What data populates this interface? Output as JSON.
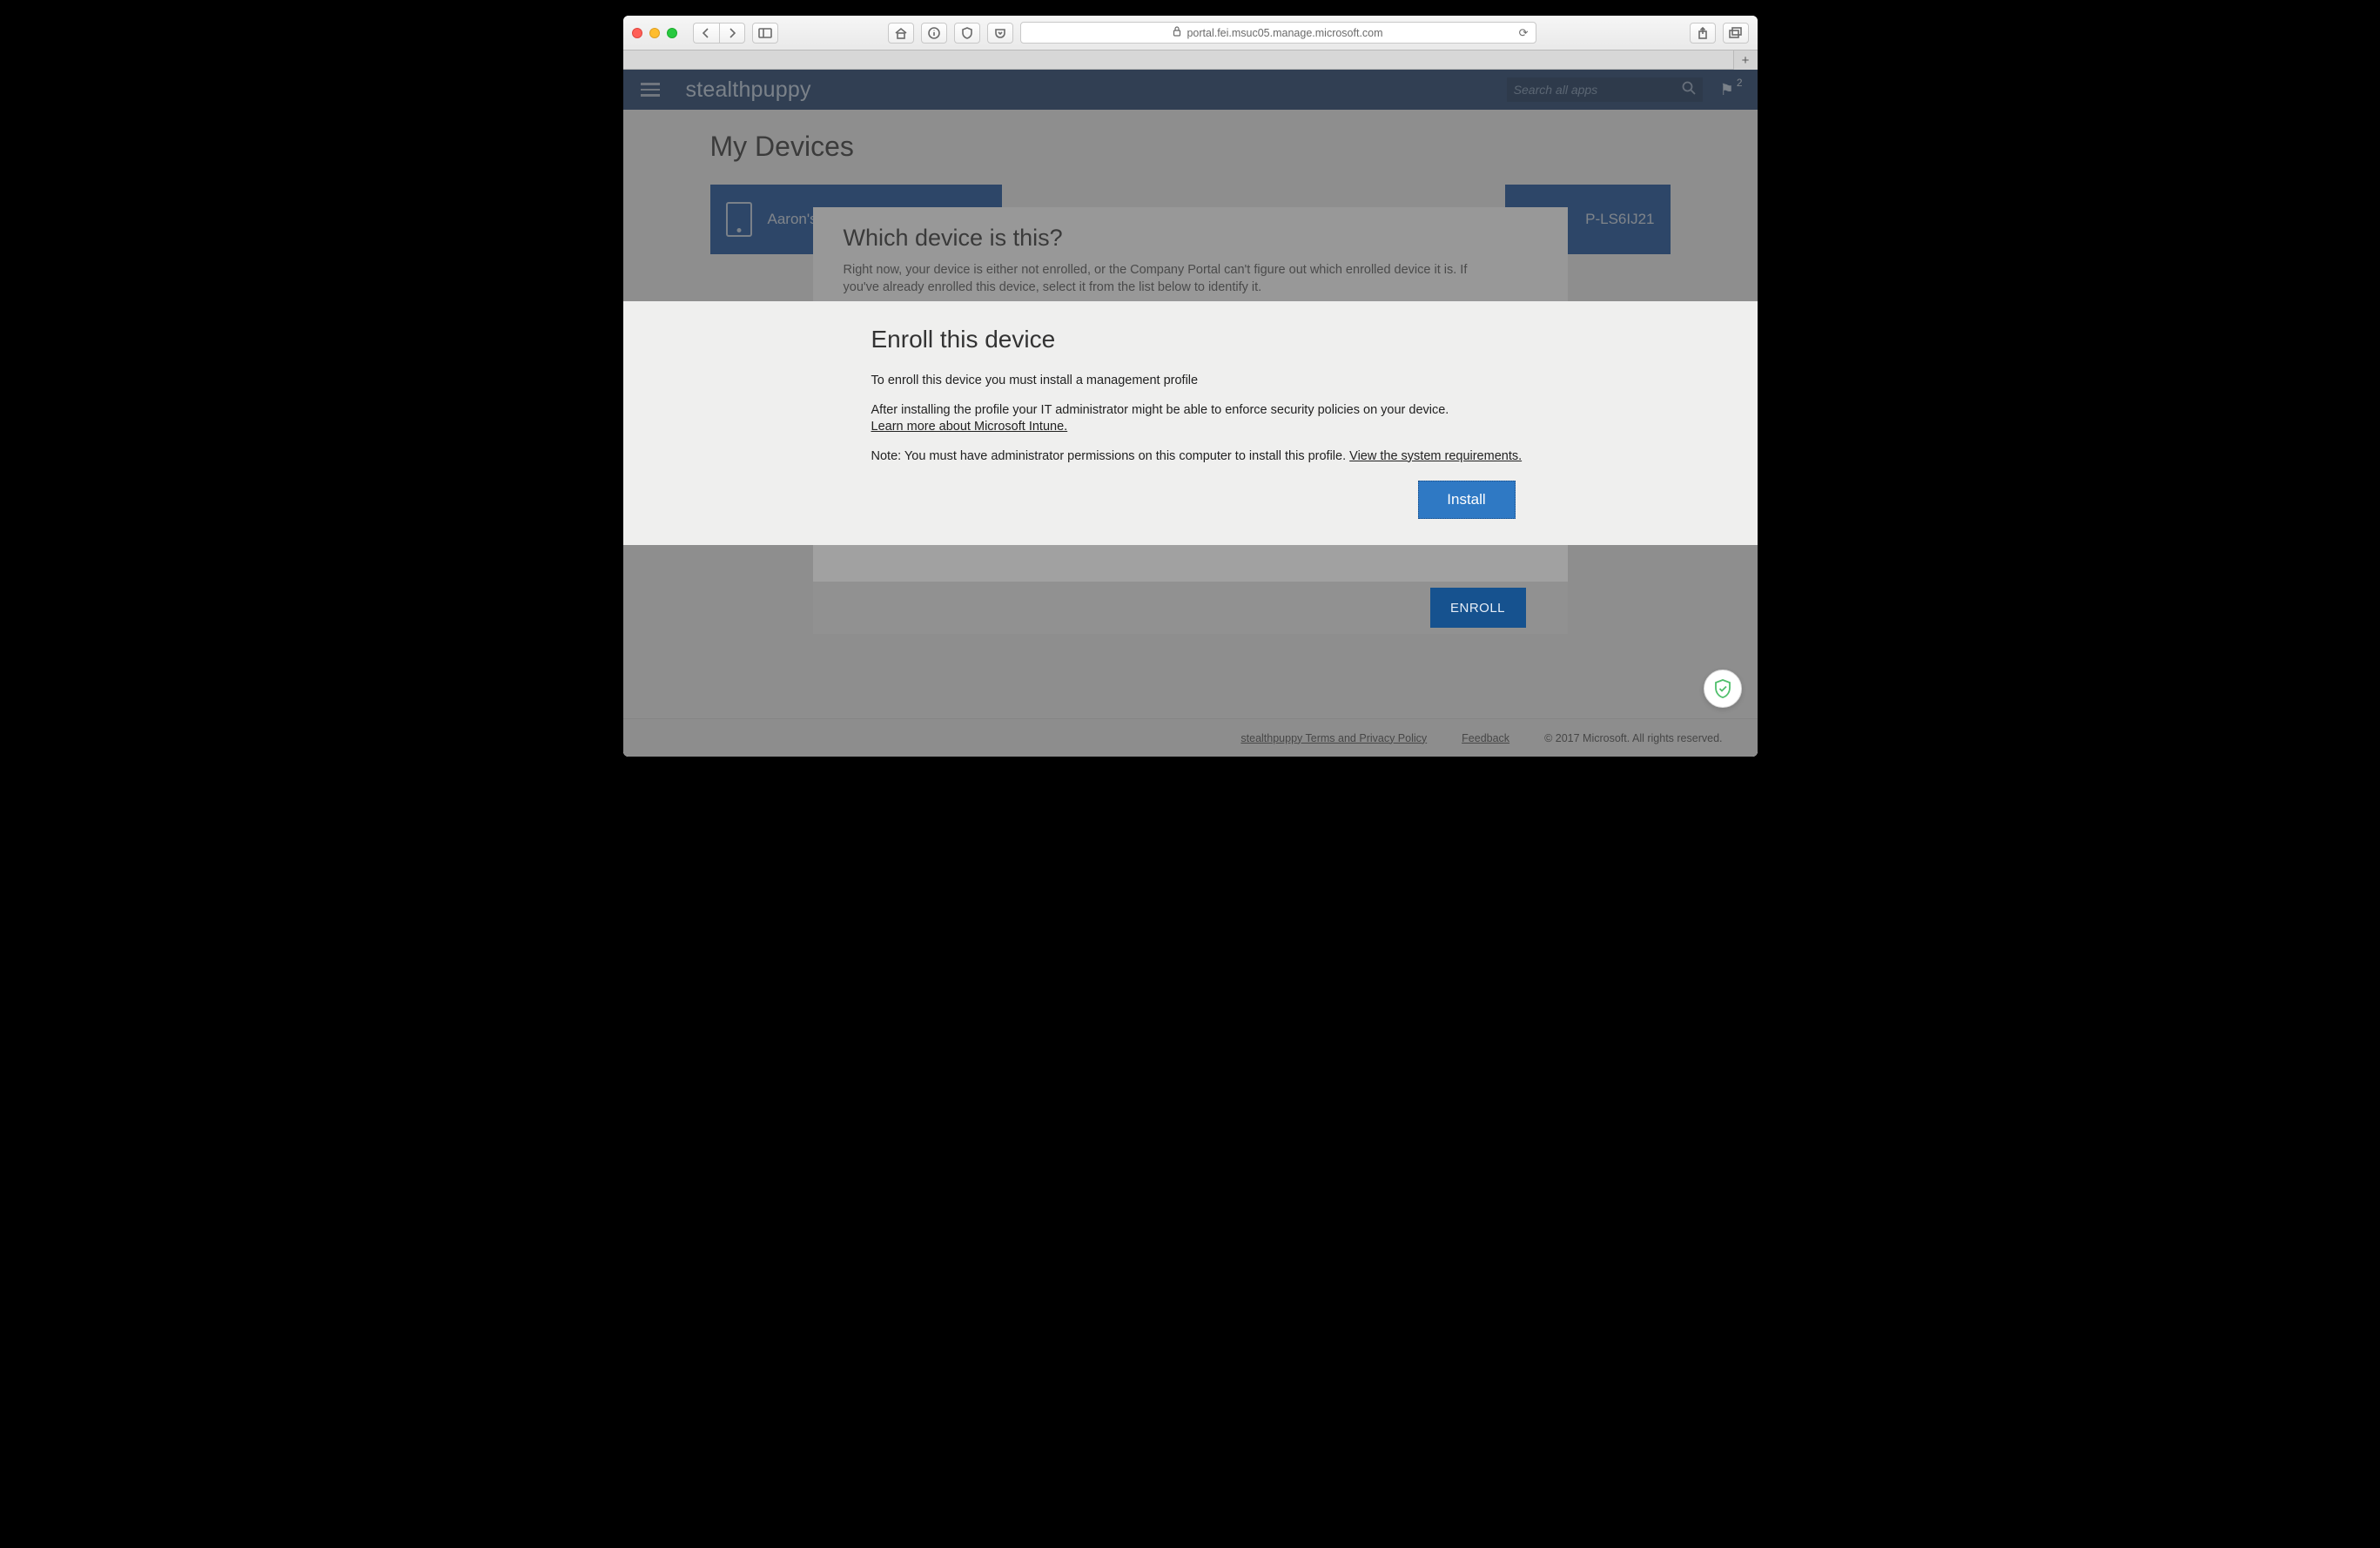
{
  "browser": {
    "url_display": "portal.fei.msuc05.manage.microsoft.com"
  },
  "portal": {
    "brand": "stealthpuppy",
    "search_placeholder": "Search all apps",
    "notification_count": "2",
    "page_title": "My Devices",
    "devices": {
      "first_label": "Aaron's",
      "last_label": "P-LS6IJ21"
    },
    "footer": {
      "terms_link": "stealthpuppy Terms and Privacy Policy",
      "feedback_link": "Feedback",
      "copyright": "© 2017 Microsoft. All rights reserved."
    }
  },
  "which_device_modal": {
    "title": "Which device is this?",
    "body": "Right now, your device is either not enrolled, or the Company Portal can't figure out which enrolled device it is. If you've already enrolled this device, select it from the list below to identify it.",
    "enroll_button": "ENROLL"
  },
  "enroll_sheet": {
    "title": "Enroll this device",
    "line1": "To enroll this device you must install a management profile",
    "line2_prefix": "After installing the profile your IT administrator might be able to enforce security policies on your device.",
    "learn_more": "Learn more about Microsoft Intune.",
    "note_prefix": "Note: You must have administrator permissions on this computer to install this profile. ",
    "view_req": "View the system requirements.",
    "install_button": "Install"
  }
}
